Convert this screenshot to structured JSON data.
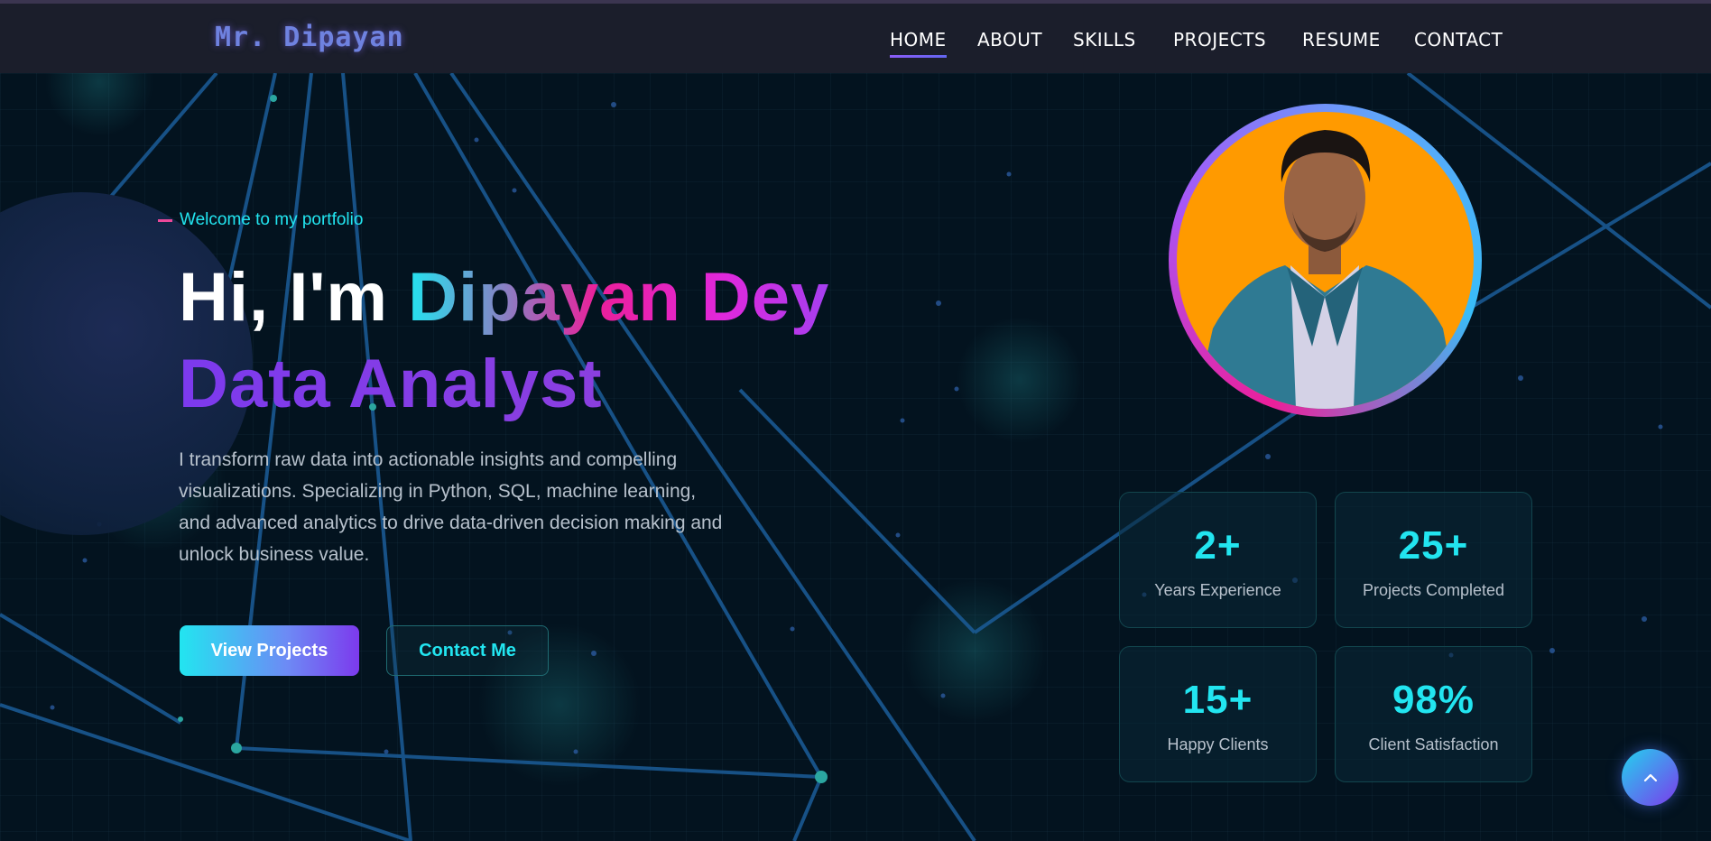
{
  "nav": {
    "brand": "Mr. Dipayan",
    "links": [
      {
        "label": "HOME",
        "active": true
      },
      {
        "label": "ABOUT",
        "active": false
      },
      {
        "label": "SKILLS",
        "active": false
      },
      {
        "label": "PROJECTS",
        "active": false
      },
      {
        "label": "RESUME",
        "active": false
      },
      {
        "label": "CONTACT",
        "active": false
      }
    ]
  },
  "hero": {
    "kicker": "Welcome to my portfolio",
    "greeting": "Hi, I'm",
    "name": "Dipayan Dey",
    "role": "Data Analyst",
    "description": "I transform raw data into actionable insights and compelling visualizations. Specializing in Python, SQL, machine learning, and advanced analytics to drive data-driven decision making and unlock business value.",
    "primary_button": "View Projects",
    "secondary_button": "Contact Me"
  },
  "stats": [
    {
      "value": "2+",
      "label": "Years Experience"
    },
    {
      "value": "25+",
      "label": "Projects Completed"
    },
    {
      "value": "15+",
      "label": "Happy Clients"
    },
    {
      "value": "98%",
      "label": "Client Satisfaction"
    }
  ],
  "icons": {
    "scroll_top": "chevron-up-icon"
  },
  "colors": {
    "accent_cyan": "#22e5f0",
    "accent_pink": "#ec1f9a",
    "accent_purple": "#7c3aed",
    "nav_bg": "#1b1e2b",
    "page_bg": "#03131f"
  }
}
